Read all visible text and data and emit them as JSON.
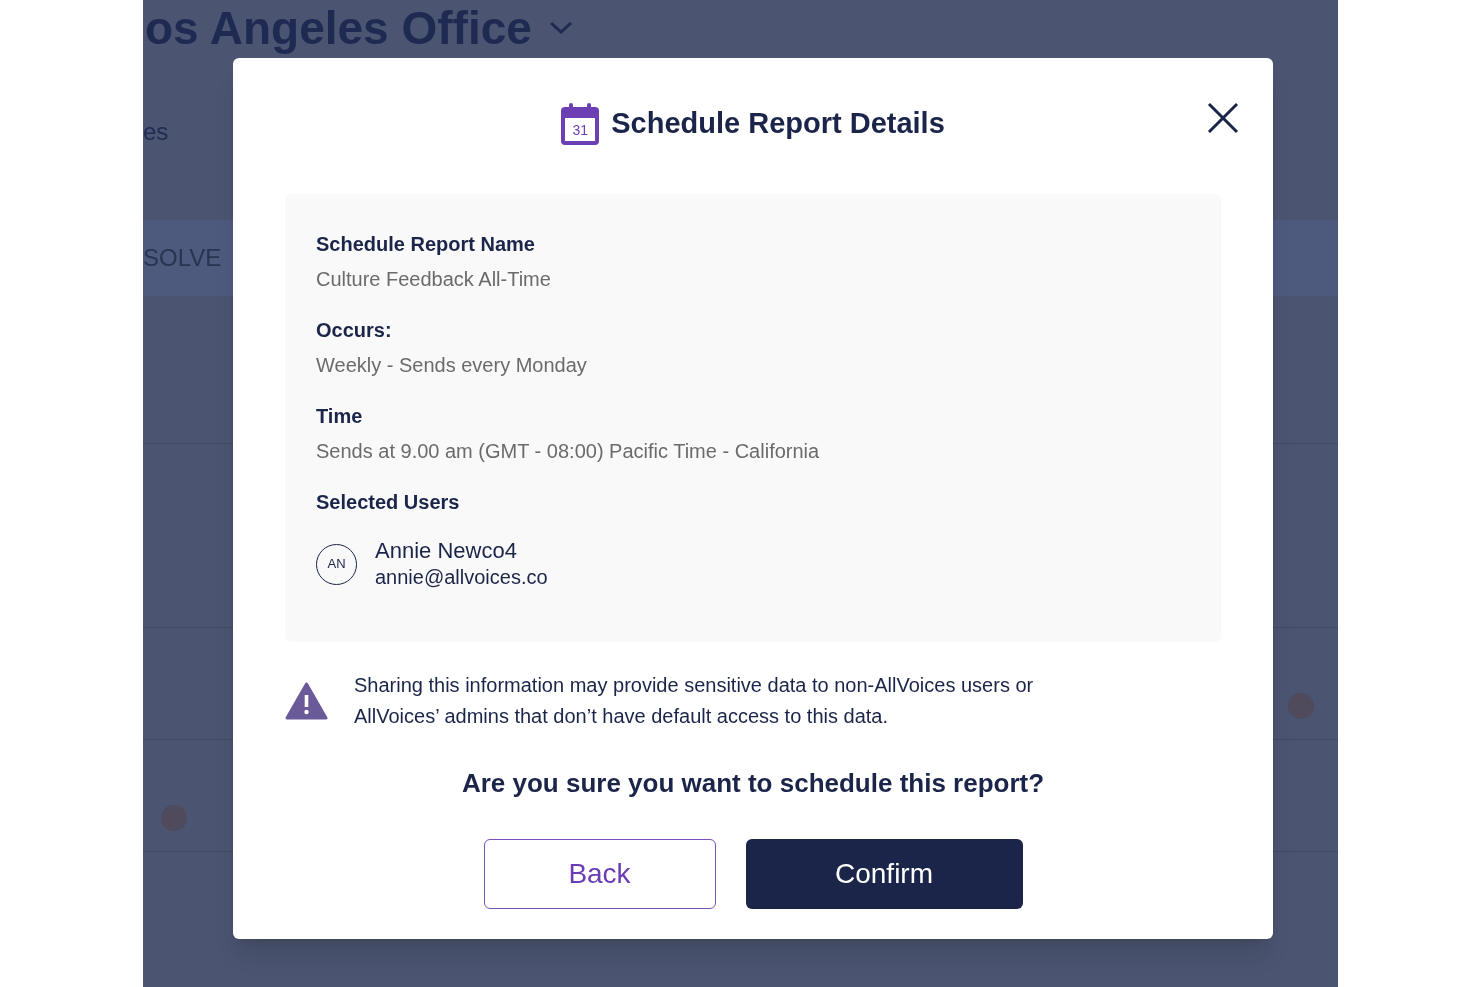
{
  "background": {
    "title": "os Angeles Office",
    "tab_fragment": "es",
    "status_fragment": "SOLVE"
  },
  "dialog": {
    "title": "Schedule Report Details",
    "calendar_day": "31",
    "fields": [
      {
        "label": "Schedule Report Name",
        "value": "Culture Feedback All-Time"
      },
      {
        "label": "Occurs:",
        "value": "Weekly - Sends every Monday"
      },
      {
        "label": "Time",
        "value": "Sends at 9.00 am (GMT - 08:00) Pacific Time - California"
      }
    ],
    "users_label": "Selected Users",
    "users": [
      {
        "initials": "AN",
        "name": "Annie Newco4",
        "email": "annie@allvoices.co"
      }
    ],
    "warning": "Sharing this information may provide sensitive data to non-AllVoices users or AllVoices’ admins that don’t have default access to this data.",
    "question": "Are you sure you want to schedule this report?",
    "buttons": [
      {
        "kind": "secondary",
        "label": "Back"
      },
      {
        "kind": "primary",
        "label": "Confirm"
      }
    ]
  }
}
